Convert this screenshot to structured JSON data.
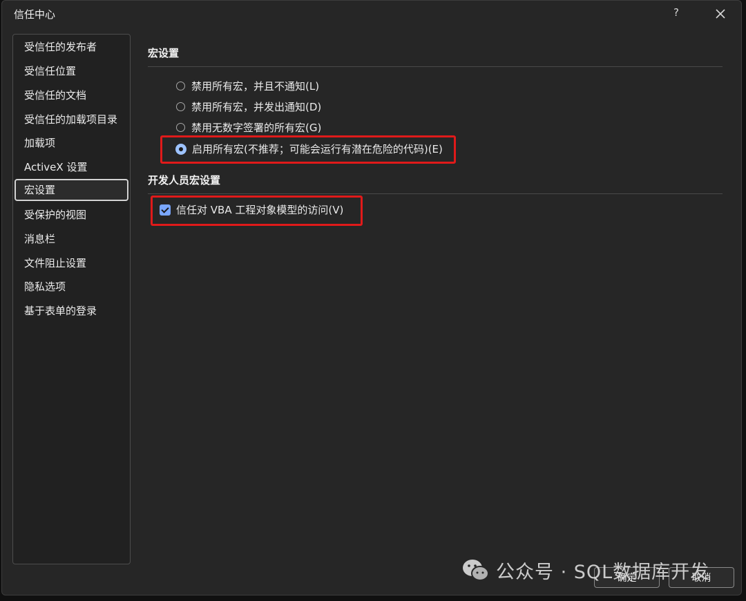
{
  "window": {
    "title": "信任中心",
    "help": "?"
  },
  "sidebar": {
    "items": [
      {
        "label": "受信任的发布者"
      },
      {
        "label": "受信任位置"
      },
      {
        "label": "受信任的文档"
      },
      {
        "label": "受信任的加载项目录"
      },
      {
        "label": "加载项"
      },
      {
        "label": "ActiveX 设置"
      },
      {
        "label": "宏设置",
        "active": true
      },
      {
        "label": "受保护的视图"
      },
      {
        "label": "消息栏"
      },
      {
        "label": "文件阻止设置"
      },
      {
        "label": "隐私选项"
      },
      {
        "label": "基于表单的登录"
      }
    ]
  },
  "macro_settings": {
    "title": "宏设置",
    "options": [
      {
        "label": "禁用所有宏，并且不通知(L)",
        "selected": false
      },
      {
        "label": "禁用所有宏，并发出通知(D)",
        "selected": false
      },
      {
        "label": "禁用无数字签署的所有宏(G)",
        "selected": false
      },
      {
        "label": "启用所有宏(不推荐；可能会运行有潜在危险的代码)(E)",
        "selected": true
      }
    ]
  },
  "developer_settings": {
    "title": "开发人员宏设置",
    "checkbox_label": "信任对 VBA 工程对象模型的访问(V)",
    "checked": true
  },
  "footer": {
    "ok_label": "确定",
    "cancel_label": "取消"
  },
  "watermark": {
    "text": "公众号 · SQL数据库开发"
  },
  "colors": {
    "highlight_border": "#e01a1a",
    "accent": "#7aa7ff"
  }
}
